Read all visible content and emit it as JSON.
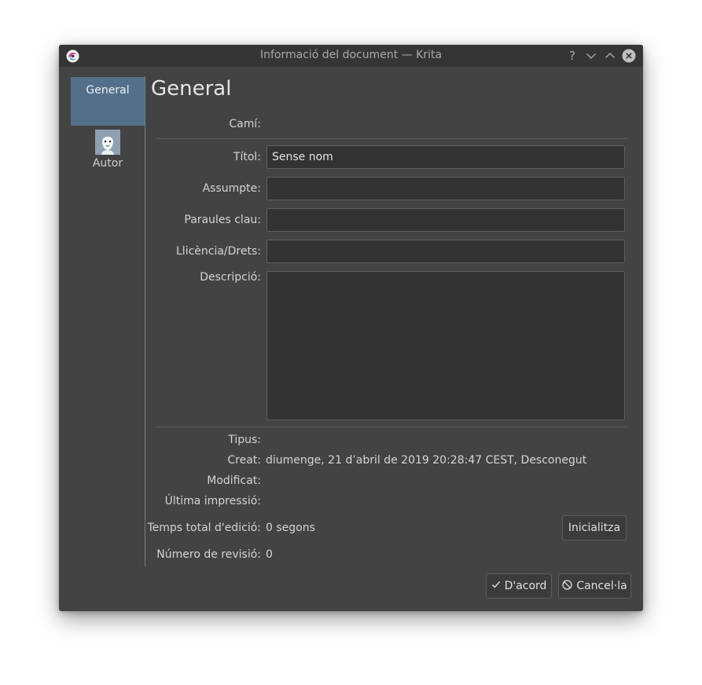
{
  "window": {
    "title": "Informació del document — Krita",
    "help_label": "?",
    "icons": {
      "app": "krita-logo-icon",
      "minimize": "chevron-down-icon",
      "maximize": "chevron-up-icon",
      "close": "close-circle-icon"
    }
  },
  "sidebar": {
    "items": [
      {
        "label": "General",
        "selected": true
      },
      {
        "label": "Autor",
        "selected": false,
        "icon": "author-avatar-icon"
      }
    ]
  },
  "page": {
    "title": "General",
    "path_label": "Camí:",
    "title_label": "Títol:",
    "title_value": "Sense nom",
    "subject_label": "Assumpte:",
    "subject_value": "",
    "keywords_label": "Paraules clau:",
    "keywords_value": "",
    "license_label": "Llicència/Drets:",
    "license_value": "",
    "description_label": "Descripció:",
    "description_value": "",
    "type_label": "Tipus:",
    "created_label": "Creat:",
    "created_value": "diumenge, 21 d’abril de 2019 20:28:47 CEST, Desconegut",
    "modified_label": "Modificat:",
    "last_print_label": "Última impressió:",
    "edit_time_label": "Temps total d'edició:",
    "edit_time_value": "0 segons",
    "reset_button": "Inicialitza",
    "revision_label": "Número de revisió:",
    "revision_value": "0"
  },
  "footer": {
    "ok_button": "D'acord",
    "cancel_button": "Cancel·la",
    "ok_icon": "checkmark-icon",
    "cancel_icon": "cancel-circle-icon"
  },
  "colors": {
    "window_bg": "#434343",
    "titlebar_bg": "#353535",
    "selection_bg": "#536f89",
    "field_bg": "#333333"
  }
}
